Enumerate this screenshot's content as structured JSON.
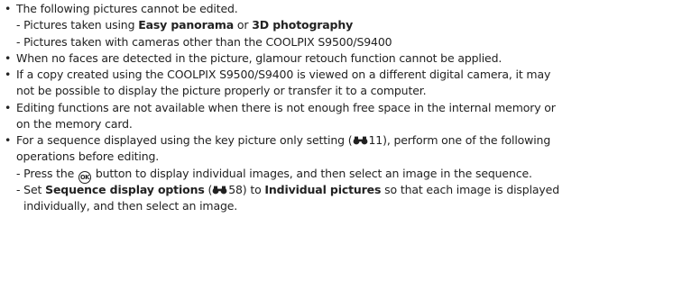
{
  "notes": {
    "item1": {
      "text": "The following pictures cannot be edited.",
      "sub1_prefix": "- Pictures taken using ",
      "sub1_term1": "Easy panorama",
      "sub1_mid": " or ",
      "sub1_term2": "3D photography",
      "sub2": "- Pictures taken with cameras other than the COOLPIX S9500/S9400"
    },
    "item2": {
      "text": "When no faces are detected in the picture, glamour retouch function cannot be applied."
    },
    "item3": {
      "line1": "If a copy created using the COOLPIX S9500/S9400 is viewed on a different digital camera, it may",
      "line2": "not be possible to display the picture properly or transfer it to a computer."
    },
    "item4": {
      "line1": "Editing functions are not available when there is not enough free space in the internal memory or",
      "line2": "on the memory card."
    },
    "item5": {
      "line1_prefix": "For a sequence displayed using the key picture only setting (",
      "line1_ref": "11",
      "line1_suffix": "), perform one of the following",
      "line2": "operations before editing.",
      "sub1_prefix": "- Press the ",
      "sub1_ok": "OK",
      "sub1_suffix": " button to display individual images, and then select an image in the sequence.",
      "sub2_prefix": "- Set ",
      "sub2_term1": "Sequence display options",
      "sub2_paren_open": " (",
      "sub2_ref": "58",
      "sub2_paren_close": ") to ",
      "sub2_term2": "Individual pictures",
      "sub2_suffix": " so that each image is displayed",
      "sub2_line2": "individually, and then select an image."
    }
  },
  "glyphs": {
    "bullet": "•",
    "ref_icon": "reference-binoculars-icon",
    "ok_icon": "ok-button-icon"
  },
  "colors": {
    "text": "#222222",
    "background": "#ffffff"
  }
}
